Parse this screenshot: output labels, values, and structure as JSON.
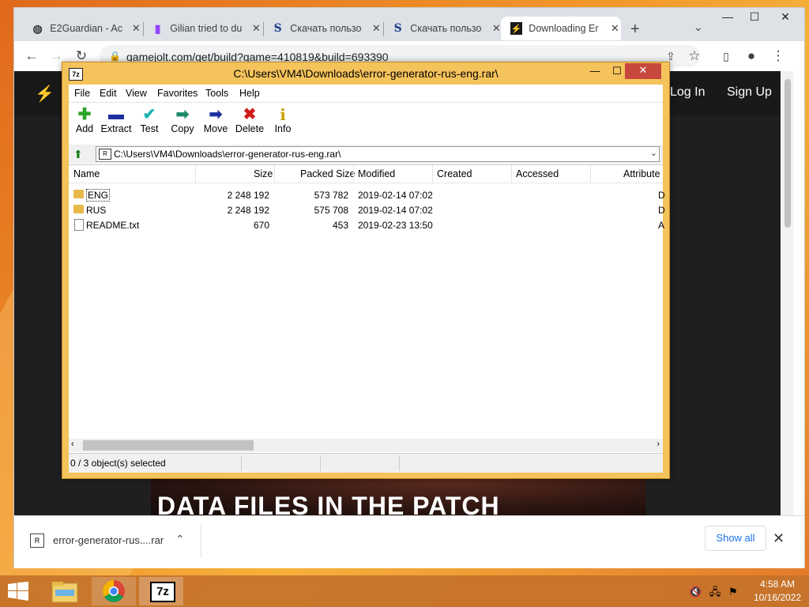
{
  "browser": {
    "tabs": [
      {
        "title": "E2Guardian - Ac",
        "icon": "globe-icon"
      },
      {
        "title": "Gilian tried to du",
        "icon": "twitch-icon"
      },
      {
        "title": "Скачать пользо",
        "icon": "s-logo-icon"
      },
      {
        "title": "Скачать пользо",
        "icon": "s-logo-icon"
      },
      {
        "title": "Downloading Er",
        "icon": "gamejolt-icon",
        "active": true
      }
    ],
    "url": "gamejolt.com/get/build?game=410819&build=693390"
  },
  "page": {
    "login": "Log In",
    "signup": "Sign Up",
    "headline": "DATA FILES IN THE PATCH"
  },
  "downloads": {
    "filename": "error-generator-rus....rar",
    "show_all": "Show all"
  },
  "sevenzip": {
    "title": "C:\\Users\\VM4\\Downloads\\error-generator-rus-eng.rar\\",
    "app_icon": "7z",
    "menu": [
      "File",
      "Edit",
      "View",
      "Favorites",
      "Tools",
      "Help"
    ],
    "toolbar": [
      "Add",
      "Extract",
      "Test",
      "Copy",
      "Move",
      "Delete",
      "Info"
    ],
    "address": "C:\\Users\\VM4\\Downloads\\error-generator-rus-eng.rar\\",
    "columns": [
      "Name",
      "Size",
      "Packed Size",
      "Modified",
      "Created",
      "Accessed",
      "Attribute"
    ],
    "files": [
      {
        "name": "ENG",
        "size": "2 248 192",
        "packed": "573 782",
        "modified": "2019-02-14 07:02",
        "attr": "D",
        "type": "folder"
      },
      {
        "name": "RUS",
        "size": "2 248 192",
        "packed": "575 708",
        "modified": "2019-02-14 07:02",
        "attr": "D",
        "type": "folder"
      },
      {
        "name": "README.txt",
        "size": "670",
        "packed": "453",
        "modified": "2019-02-23 13:50",
        "attr": "A",
        "type": "file"
      }
    ],
    "status": "0 / 3 object(s) selected"
  },
  "taskbar": {
    "time": "4:58 AM",
    "date": "10/16/2022",
    "sevenzip_label": "7z"
  }
}
